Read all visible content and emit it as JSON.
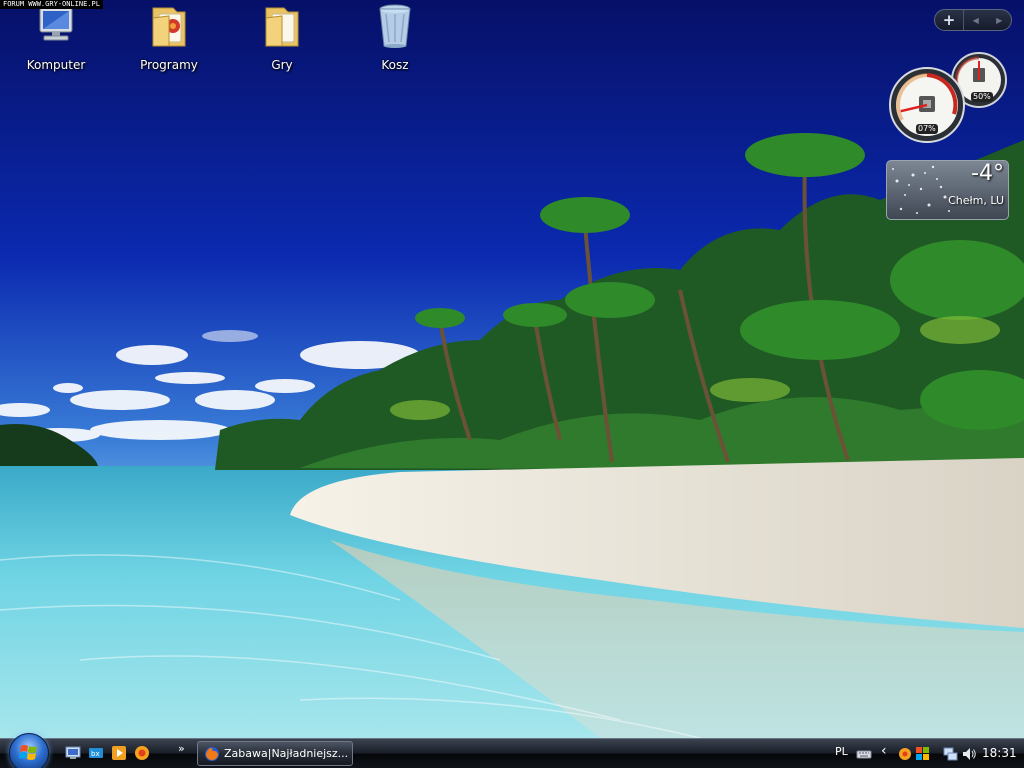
{
  "watermark": "FORUM WWW.GRY-ONLINE.PL",
  "desktop_icons": [
    {
      "label": "Komputer",
      "icon": "computer-icon"
    },
    {
      "label": "Programy",
      "icon": "programs-folder-icon"
    },
    {
      "label": "Gry",
      "icon": "games-folder-icon"
    },
    {
      "label": "Kosz",
      "icon": "recycle-bin-icon"
    }
  ],
  "gadget_controls": {
    "add_label": "+",
    "prev_label": "◀",
    "next_label": "▶"
  },
  "cpu_meter": {
    "cpu_percent_label": "07%",
    "memory_percent_label": "50%",
    "cpu_percent": 7,
    "memory_percent": 50
  },
  "weather": {
    "temperature": "-4°",
    "location": "Chełm, LU"
  },
  "taskbar": {
    "quick_more": "»",
    "task_button_title": "Zabawa|Najładniejsz...",
    "language": "PL",
    "tray_chevron": "‹",
    "clock": "18:31"
  },
  "colors": {
    "sky_top": "#0a1a8c",
    "sky_bottom": "#6aa8e8",
    "sand": "#f2ece0",
    "water": "#4fc6dc"
  }
}
